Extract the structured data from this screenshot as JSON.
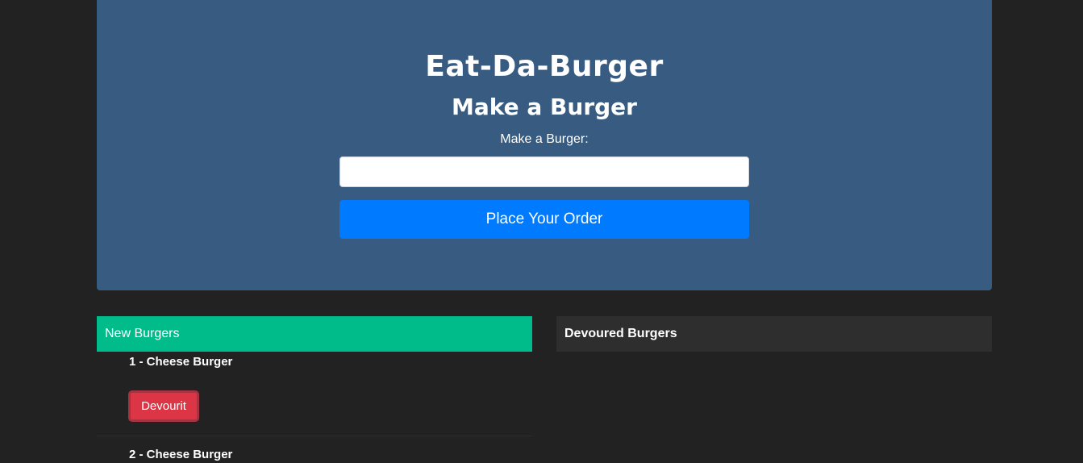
{
  "app_title": "Eat-Da-Burger",
  "form": {
    "heading": "Make a Burger",
    "label": "Make a Burger:",
    "input_value": "",
    "submit_label": "Place Your Order"
  },
  "new_burgers": {
    "header": "New Burgers",
    "items": [
      {
        "name": "1 - Cheese Burger",
        "action_label": "Devourit"
      },
      {
        "name": "2 - Cheese Burger"
      }
    ]
  },
  "devoured_burgers": {
    "header": "Devoured Burgers",
    "items": []
  },
  "colors": {
    "page_bg": "#222222",
    "hero_bg": "#385c81",
    "primary": "#007bff",
    "new_header": "#00bb8a",
    "devoured_header": "#2e2e2e",
    "danger": "#dc3545"
  }
}
